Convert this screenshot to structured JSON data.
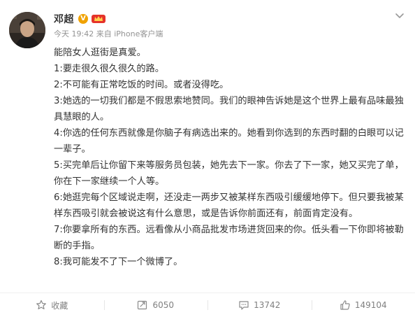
{
  "post": {
    "user_name": "邓超",
    "vip_badge": "V",
    "time": "今天 19:42",
    "source_prefix": "来自",
    "source": "iPhone客户端",
    "paragraphs": [
      "能陪女人逛街是真爱。",
      "1:要走很久很久很久的路。",
      "2:不可能有正常吃饭的时间。或者没得吃。",
      "3:她选的一切我们都是不假思索地赞同。我们的眼神告诉她是这个世界上最有品味最独具慧眼的人。",
      "4:你选的任何东西就像是你脑子有病选出来的。她看到你选到的东西时翻的白眼可以记一辈子。",
      "5:买完单后让你留下来等服务员包装，她先去下一家。你去了下一家，她又买完了单，你在下一家继续一个人等。",
      "6:她逛完每个区域说走啊，还没走一两步又被某样东西吸引缓缓地停下。但只要我被某样东西吸引就会被说这有什么意思，或是告诉你前面还有，前面肯定没有。",
      "7:你要拿所有的东西。远看像从小商品批发市场进货回来的你。低头看一下你即将被勒断的手指。",
      "8:我可能发不了下一个微博了。"
    ]
  },
  "actions": {
    "favorite_label": "收藏",
    "repost_count": "6050",
    "comment_count": "13742",
    "like_count": "149104"
  },
  "icons": {
    "more": "chevron-down-icon",
    "favorite": "star-icon",
    "repost": "repost-icon",
    "comment": "comment-icon",
    "like": "thumbs-up-icon",
    "vip": "verified-v-icon",
    "member": "member-crown-icon"
  },
  "colors": {
    "text": "#333333",
    "meta": "#939393",
    "action_text": "#808080",
    "vip_orange": "#f0a202",
    "member_red": "#e5332a"
  }
}
